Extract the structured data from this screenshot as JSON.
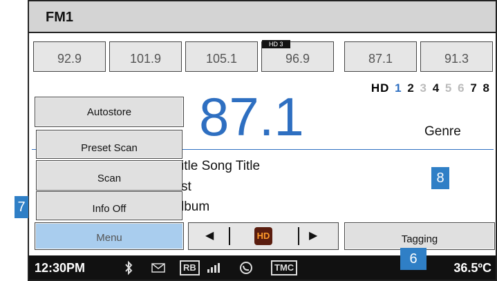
{
  "header": {
    "title": "FM1"
  },
  "presets": [
    {
      "label": "92.9"
    },
    {
      "label": "101.9"
    },
    {
      "label": "105.1"
    },
    {
      "label": "96.9",
      "tag": "HD 3"
    },
    {
      "label": "87.1"
    },
    {
      "label": "91.3"
    }
  ],
  "hd_channels": {
    "prefix": "HD",
    "items": [
      {
        "label": "1",
        "color": "#2e6fc1"
      },
      {
        "label": "2",
        "color": "#111111"
      },
      {
        "label": "3",
        "color": "#bbbbbb"
      },
      {
        "label": "4",
        "color": "#111111"
      },
      {
        "label": "5",
        "color": "#bbbbbb"
      },
      {
        "label": "6",
        "color": "#bbbbbb"
      },
      {
        "label": "7",
        "color": "#111111"
      },
      {
        "label": "8",
        "color": "#111111"
      }
    ]
  },
  "now_playing": {
    "frequency": "87.1",
    "genre": "Genre",
    "song_line": "itle   Song Title",
    "artist_line": "st",
    "album_line": "lbum"
  },
  "menu": {
    "items": [
      "Autostore",
      "Preset Scan",
      "Scan",
      "Info Off"
    ],
    "menu_label": "Menu"
  },
  "controls": {
    "prev_glyph": "◀",
    "next_glyph": "▶",
    "hd_logo": "HD",
    "tagging_label": "Tagging"
  },
  "callouts": {
    "c7": "7",
    "c8": "8",
    "c6": "6"
  },
  "status_bar": {
    "time": "12:30PM",
    "rds": "RB",
    "tmc": "TMC",
    "temperature": "36.5ºC"
  },
  "colors": {
    "accent": "#2e6fc1",
    "menu_active": "#a9cdee",
    "callout": "#2f7fc6"
  }
}
